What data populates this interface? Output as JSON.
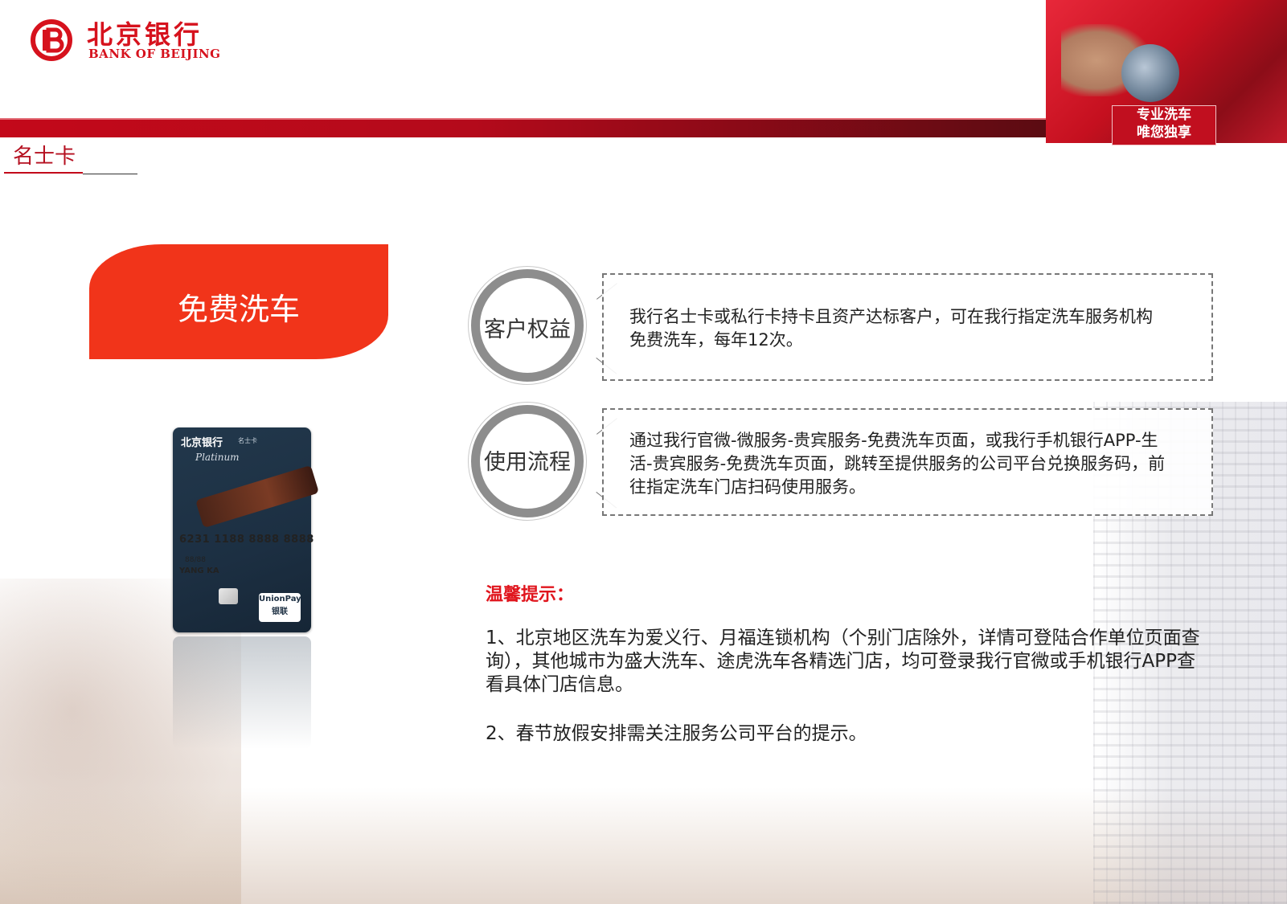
{
  "header": {
    "bank_name_cn": "北京银行",
    "bank_name_en": "BANK OF BEIJING",
    "promo_label_line1": "专业洗车",
    "promo_label_line2": "唯您独享"
  },
  "page_tab": "名士卡",
  "title": "免费洗车",
  "card": {
    "bank": "北京银行",
    "subtitle": "名士卡",
    "tier": "Platinum",
    "number": "6231 1188 8888 8888",
    "expiry": "88/88",
    "holder": "YANG KA",
    "network": "UnionPay",
    "network_cn": "银联"
  },
  "benefit": {
    "label": "客户权益",
    "text": "我行名士卡或私行卡持卡且资产达标客户，可在我行指定洗车服务机构免费洗车，每年12次。"
  },
  "process": {
    "label": "使用流程",
    "text": "通过我行官微-微服务-贵宾服务-免费洗车页面，或我行手机银行APP-生活-贵宾服务-免费洗车页面，跳转至提供服务的公司平台兑换服务码，前往指定洗车门店扫码使用服务。"
  },
  "tips": {
    "title": "温馨提示：",
    "item1": "1、北京地区洗车为爱义行、月福连锁机构（个别门店除外，详情可登陆合作单位页面查询），其他城市为盛大洗车、途虎洗车各精选门店，均可登录我行官微或手机银行APP查看具体门店信息。",
    "item2": "2、春节放假安排需关注服务公司平台的提示。"
  },
  "colors": {
    "brand_red": "#d6121d",
    "title_pill": "#f1341a",
    "tip_red": "#e0151d"
  }
}
